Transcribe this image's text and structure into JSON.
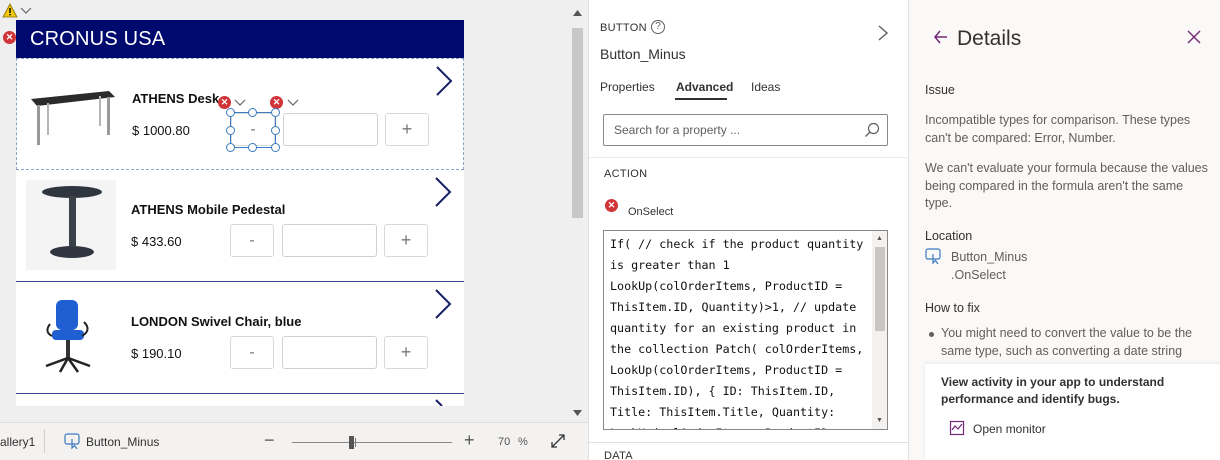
{
  "canvas": {
    "app_title": "CRONUS USA",
    "items": [
      {
        "name": "ATHENS Desk",
        "price": "$ 1000.80",
        "minus_label": "-",
        "plus_label": "+",
        "image": "desk"
      },
      {
        "name": "ATHENS Mobile Pedestal",
        "price": "$ 433.60",
        "minus_label": "-",
        "plus_label": "+",
        "image": "pedestal"
      },
      {
        "name": "LONDON Swivel Chair, blue",
        "price": "$ 190.10",
        "minus_label": "-",
        "plus_label": "+",
        "image": "swivel-chair"
      }
    ],
    "warning_icon": "warning-triangle-icon",
    "error_icon": "error-x-icon"
  },
  "status_bar": {
    "gallery_crumb": "allery1",
    "control_crumb": "Button_Minus",
    "zoom_minus": "−",
    "zoom_plus": "+",
    "zoom_value": "70",
    "zoom_unit": "%"
  },
  "properties": {
    "control_type": "BUTTON",
    "help_glyph": "?",
    "control_name": "Button_Minus",
    "tabs": [
      "Properties",
      "Advanced",
      "Ideas"
    ],
    "active_tab": "Advanced",
    "search_placeholder": "Search for a property ...",
    "section_action": "ACTION",
    "property_name": "OnSelect",
    "formula": "If( // check if the product quantity is greater than 1 LookUp(colOrderItems, ProductID = ThisItem.ID, Quantity)>1, // update quantity for an existing product in the collection Patch( colOrderItems, LookUp(colOrderItems, ProductID = ThisItem.ID), { ID: ThisItem.ID, Title: ThisItem.Title, Quantity: LookUp(colOrderItems, ProductID =",
    "section_data": "DATA"
  },
  "details": {
    "title": "Details",
    "issue_label": "Issue",
    "issue_text": "Incompatible types for comparison. These types can't be compared: Error, Number.",
    "explanation": "We can't evaluate your formula because the values being compared in the formula aren't the same type.",
    "location_label": "Location",
    "location_control": "Button_Minus",
    "location_property": ".OnSelect",
    "fix_label": "How to fix",
    "fix_text": "You might need to convert the value to be the same type, such as converting a date string",
    "monitor_text": "View activity in your app to understand performance and identify bugs.",
    "monitor_link": "Open monitor"
  },
  "colors": {
    "header_bg": "#000a6e",
    "accent_purple": "#742774",
    "error_red": "#d13438",
    "selection_blue": "#3c7ac1"
  }
}
